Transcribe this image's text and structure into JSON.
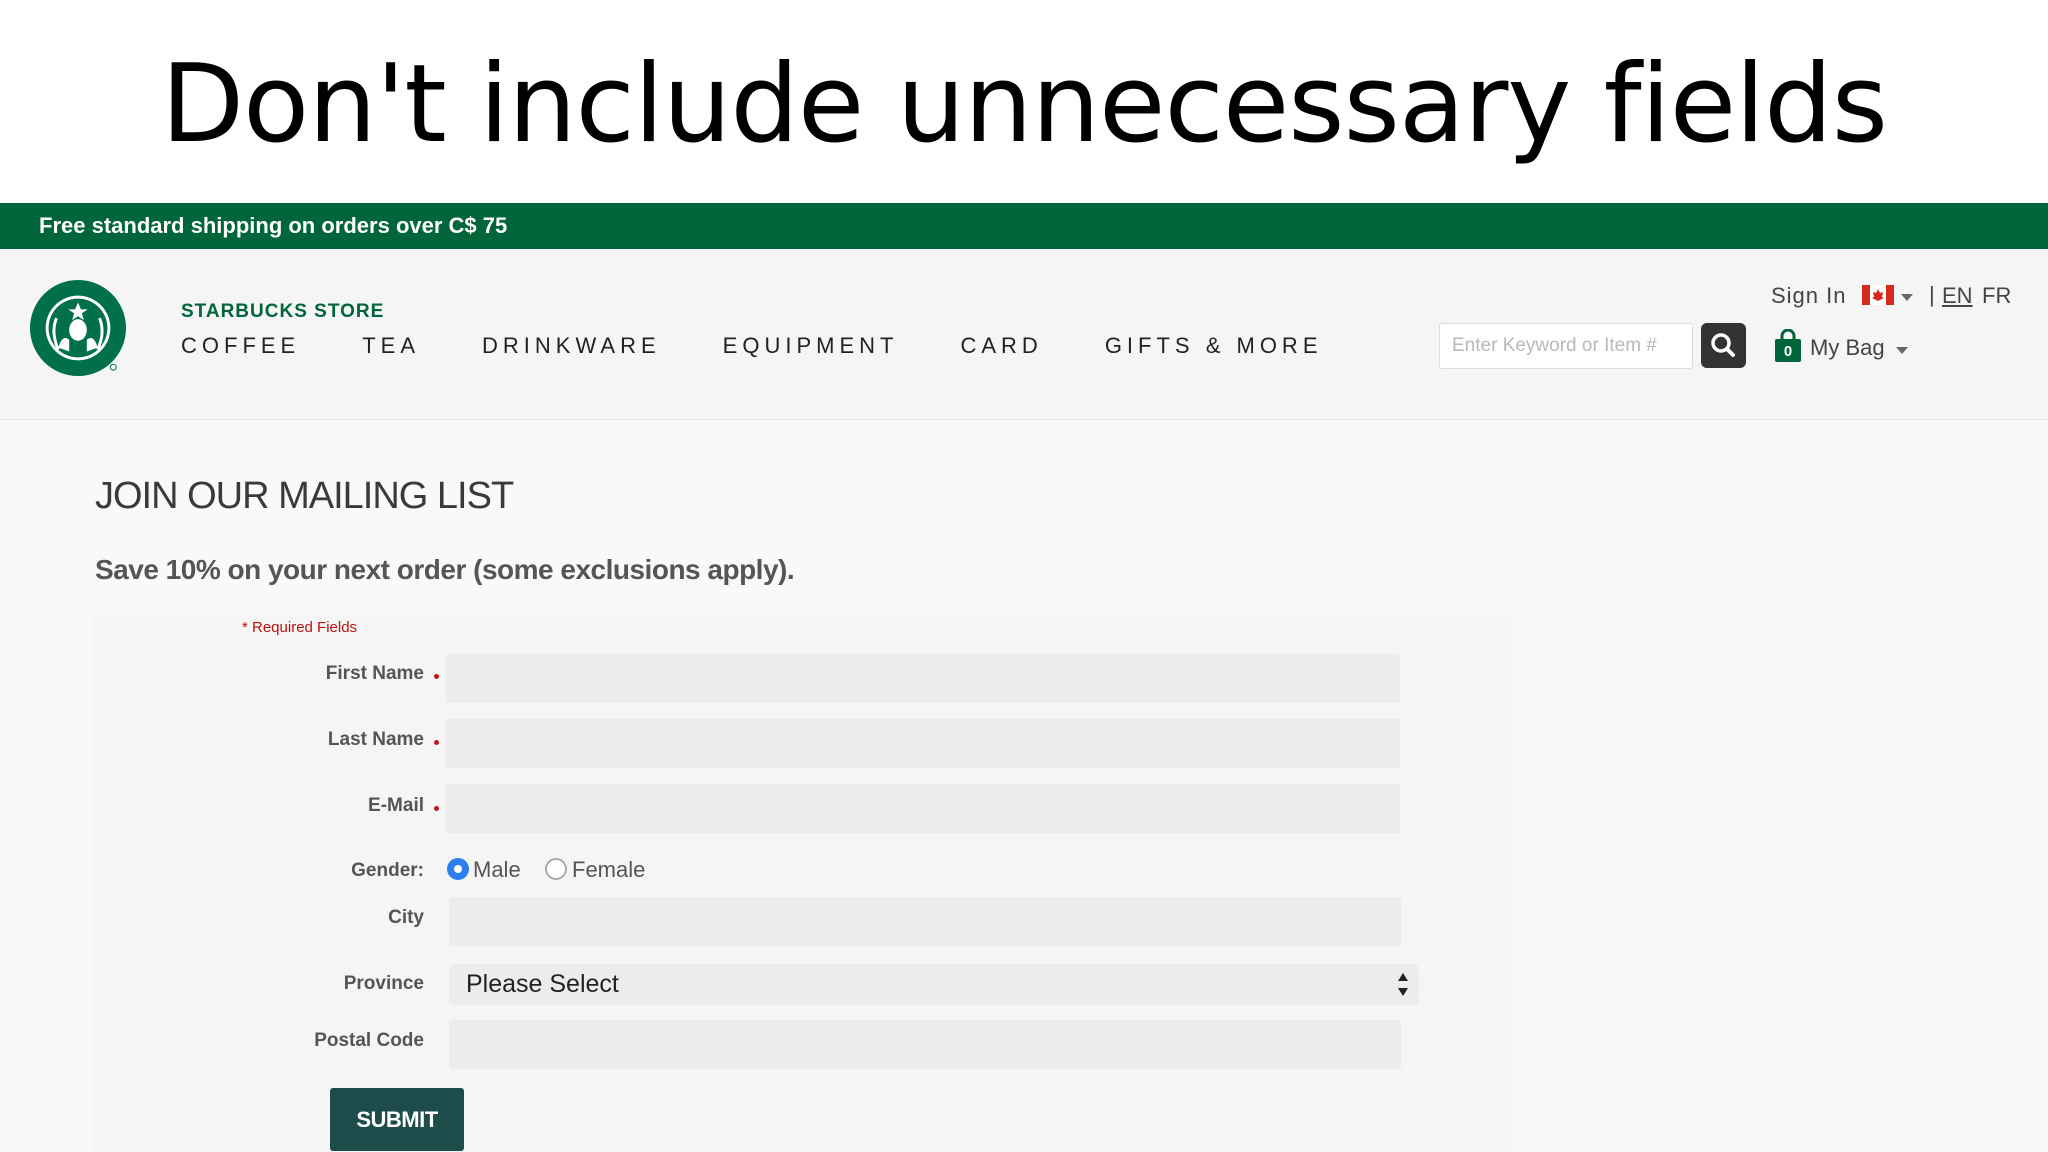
{
  "slide": {
    "title": "Don't include unnecessary fields"
  },
  "promo": {
    "text": "Free standard shipping on orders over C$ 75"
  },
  "header": {
    "store_name": "STARBUCKS STORE",
    "nav": [
      "COFFEE",
      "TEA",
      "DRINKWARE",
      "EQUIPMENT",
      "CARD",
      "GIFTS & MORE"
    ],
    "search_placeholder": "Enter Keyword or Item #",
    "sign_in": "Sign In",
    "divider": "|",
    "lang_en": "EN",
    "lang_fr": "FR",
    "bag_count": "0",
    "my_bag": "My Bag"
  },
  "form": {
    "heading": "JOIN OUR MAILING LIST",
    "subheading": "Save 10% on your next order (some exclusions apply).",
    "required_note": "* Required Fields",
    "first_name_label": "First Name",
    "last_name_label": "Last Name",
    "email_label": "E-Mail",
    "gender_label": "Gender:",
    "gender_options": [
      "Male",
      "Female"
    ],
    "gender_selected": "Male",
    "city_label": "City",
    "province_label": "Province",
    "province_value": "Please Select",
    "postal_label": "Postal Code",
    "submit_label": "SUBMIT"
  },
  "colors": {
    "brand_green": "#00653b",
    "submit_bg": "#1e4c4a",
    "required_red": "#c01818",
    "radio_selected": "#2f7ef0"
  },
  "icons": [
    "starbucks-siren-logo",
    "search-icon",
    "canada-flag-icon",
    "caret-down-icon",
    "shopping-bag-icon",
    "select-arrows-icon"
  ]
}
